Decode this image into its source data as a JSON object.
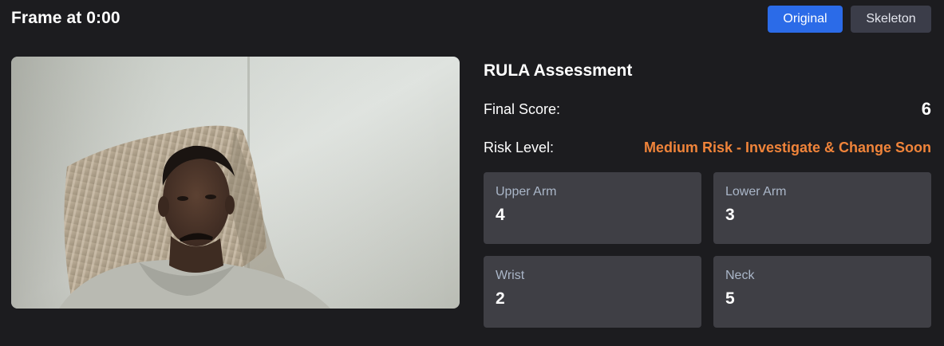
{
  "header": {
    "title": "Frame at 0:00"
  },
  "view_toggle": {
    "original_label": "Original",
    "skeleton_label": "Skeleton",
    "active": "Original"
  },
  "assessment": {
    "title": "RULA Assessment",
    "final_score_label": "Final Score:",
    "final_score": "6",
    "risk_level_label": "Risk Level:",
    "risk_level": "Medium Risk - Investigate & Change Soon",
    "risk_color": "#f0843a"
  },
  "scores": [
    {
      "label": "Upper Arm",
      "value": "4"
    },
    {
      "label": "Lower Arm",
      "value": "3"
    },
    {
      "label": "Wrist",
      "value": "2"
    },
    {
      "label": "Neck",
      "value": "5"
    }
  ],
  "colors": {
    "primary": "#2b6be8",
    "background": "#1c1c1f",
    "card": "#3f3f45"
  }
}
